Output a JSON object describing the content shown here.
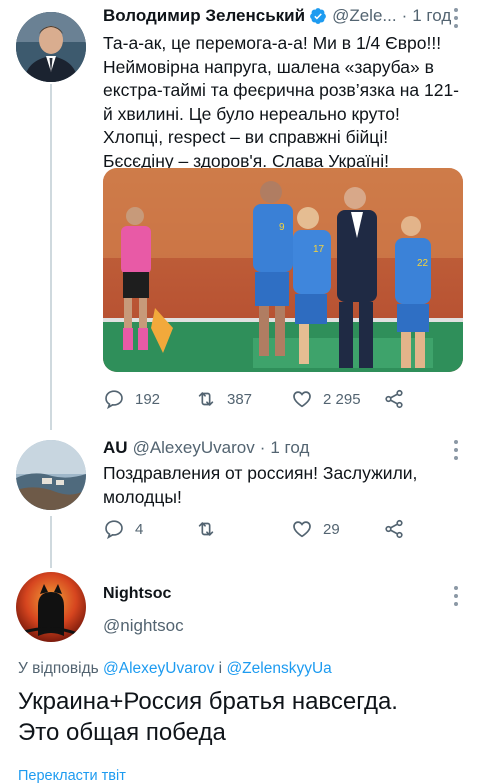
{
  "tweets": [
    {
      "author_name": "Володимир Зеленський",
      "handle": "@Zele...",
      "separator": "·",
      "time": "1 год",
      "text": "Та-а-ак, це перемога-а-а! Ми в 1/4 Євро!!! Неймовірна напруга, шалена «заруба» в екстра-таймі та феєрична розв’язка на 121-й хвилині. Це було нереально круто! Хлопці, respect – ви справжні бійці! Бєсєдіну – здоров'я. Слава Україні!",
      "replies": "192",
      "retweets": "387",
      "likes": "2 295"
    },
    {
      "author_name": "AU",
      "handle": "@AlexeyUvarov",
      "separator": "·",
      "time": "1 год",
      "text": "Поздравления от россиян! Заслужили, молодцы!",
      "replies": "4",
      "retweets": "",
      "likes": "29"
    },
    {
      "author_name": "Nightsoc",
      "handle": "@nightsoc",
      "reply_prefix": "У відповідь",
      "reply_user_1": "@AlexeyUvarov",
      "reply_conjunction": "і",
      "reply_user_2": "@ZelenskyyUa",
      "text_line_1": "Украина+Россия братья навсегда.",
      "text_line_2": "Это общая победа",
      "translate_link": "Перекласти твіт"
    }
  ],
  "colors": {
    "text": "#0f1419",
    "secondary": "#536471",
    "link": "#1d9bf0",
    "verified": "#1d9bf0",
    "thread_line": "#cfd9de"
  },
  "icons": [
    "reply-icon",
    "retweet-icon",
    "like-icon",
    "share-icon",
    "verified-icon",
    "more-icon"
  ]
}
